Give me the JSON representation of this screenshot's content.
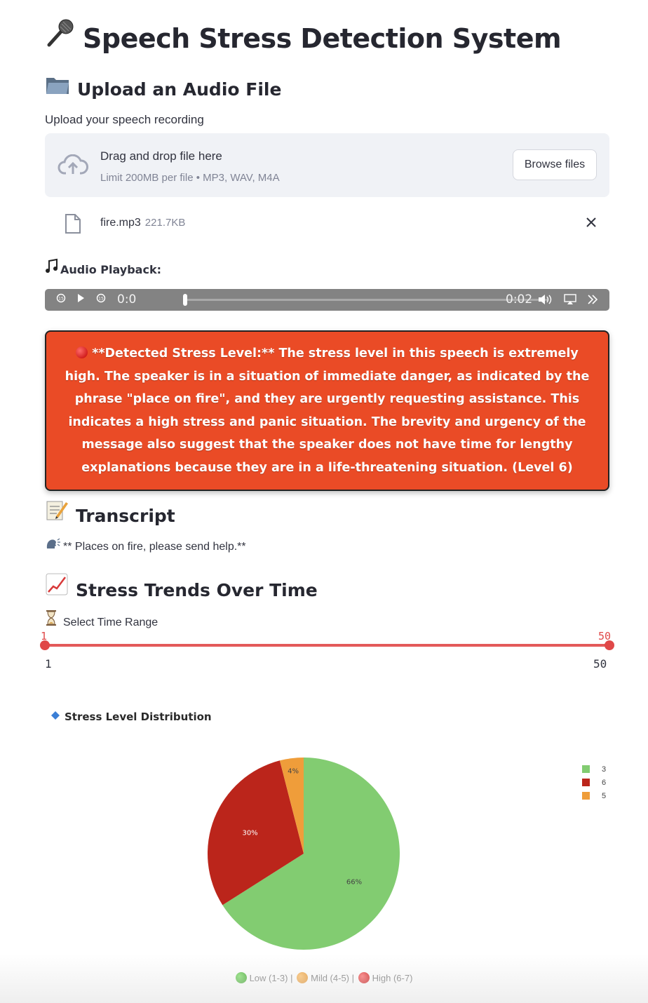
{
  "page": {
    "title": "Speech Stress Detection System",
    "title_icon": "microphone-icon"
  },
  "upload": {
    "heading": "Upload an Audio File",
    "heading_icon": "folder-icon",
    "label": "Upload your speech recording",
    "drag_text": "Drag and drop file here",
    "limit_text": "Limit 200MB per file • MP3, WAV, M4A",
    "browse_label": "Browse files",
    "file": {
      "name": "fire.mp3",
      "size": "221.7KB"
    }
  },
  "audio": {
    "label": "Audio Playback:",
    "label_icon": "music-note-icon",
    "current_time": "0:0",
    "duration": "0:02"
  },
  "alert": {
    "text": "**Detected Stress Level:** The stress level in this speech is extremely high. The speaker is in a situation of immediate danger, as indicated by the phrase \"place on fire\", and they are urgently requesting assistance. This indicates a high stress and panic situation. The brevity and urgency of the message also suggest that the speaker does not have time for lengthy explanations because they are in a life-threatening situation. (Level 6)",
    "color": "#ea4b26"
  },
  "transcript": {
    "heading": "Transcript",
    "heading_icon": "memo-icon",
    "text": "** Places on fire, please send help.**",
    "text_icon": "speaking-head-icon"
  },
  "trends": {
    "heading": "Stress Trends Over Time",
    "heading_icon": "chart-increasing-icon",
    "range_label": "Select Time Range",
    "range_icon": "hourglass-icon",
    "range_min": "1",
    "range_max": "50",
    "selected_low": "1",
    "selected_high": "50"
  },
  "chart_data": {
    "type": "pie",
    "title": "Stress Level Distribution",
    "title_icon": "blue-diamond-icon",
    "slices": [
      {
        "label": "3",
        "value": 66,
        "display": "66%",
        "color": "#82cc71"
      },
      {
        "label": "6",
        "value": 30,
        "display": "30%",
        "color": "#bb251b"
      },
      {
        "label": "5",
        "value": 4,
        "display": "4%",
        "color": "#ef9d3a"
      }
    ],
    "legend_placement": "top-right"
  },
  "footer_legend": {
    "low": "Low (1-3) |",
    "mild": "Mild (4-5) |",
    "high": "High (6-7)"
  }
}
